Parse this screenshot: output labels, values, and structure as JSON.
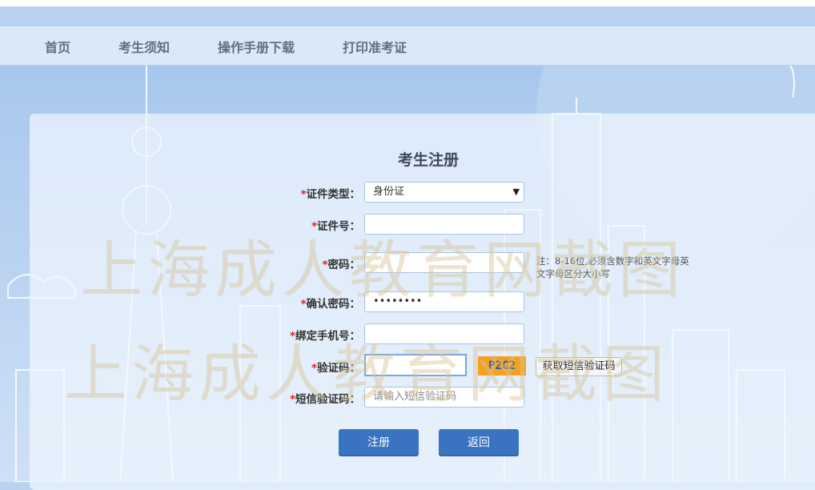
{
  "nav": {
    "items": [
      "首页",
      "考生须知",
      "操作手册下载",
      "打印准考证"
    ]
  },
  "form": {
    "title": "考生注册",
    "required_mark": "*",
    "fields": [
      {
        "label": "证件类型：",
        "value": "身份证"
      },
      {
        "label": "证件号：",
        "value": ""
      },
      {
        "label": "密码：",
        "value": ""
      },
      {
        "label": "确认密码：",
        "value": "••••••••"
      },
      {
        "label": "绑定手机号：",
        "value": ""
      },
      {
        "label": "验证码：",
        "value": ""
      },
      {
        "label": "短信验证码：",
        "value": "",
        "placeholder": "请输入短信验证码"
      }
    ],
    "password_hint": "注：8-16位,必须含数字和英文字母英文字母区分大小写",
    "captcha_text": "P2C2",
    "sms_button": "获取短信验证码",
    "submit_button": "注册",
    "back_button": "返回"
  },
  "watermark": {
    "text": "上海成人教育网截图"
  },
  "colors": {
    "accent": "#3a73c2",
    "captcha_bg": "#f5a11e",
    "required": "#e02020"
  },
  "icons": {
    "select_arrow": "dropdown-arrow-icon"
  }
}
